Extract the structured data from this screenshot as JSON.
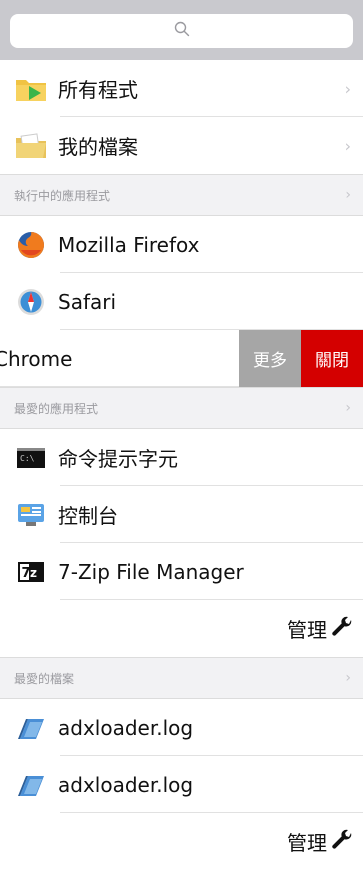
{
  "search": {
    "icon": "search-icon"
  },
  "top_items": [
    {
      "label": "所有程式",
      "icon": "folder-icon"
    },
    {
      "label": "我的檔案",
      "icon": "documents-folder-icon"
    }
  ],
  "running_section": {
    "title": "執行中的應用程式"
  },
  "running_apps": [
    {
      "label": "Mozilla Firefox",
      "icon": "firefox-icon"
    },
    {
      "label": "Safari",
      "icon": "safari-icon"
    }
  ],
  "swiped_row": {
    "label": "Chrome",
    "more_label": "更多",
    "close_label": "關閉"
  },
  "favorite_apps_section": {
    "title": "最愛的應用程式"
  },
  "favorite_apps": [
    {
      "label": "命令提示字元",
      "icon": "terminal-icon"
    },
    {
      "label": "控制台",
      "icon": "control-panel-icon"
    },
    {
      "label": "7-Zip File Manager",
      "icon": "7zip-icon"
    }
  ],
  "manage_label": "管理",
  "favorite_files_section": {
    "title": "最愛的檔案"
  },
  "favorite_files": [
    {
      "label": "adxloader.log",
      "icon": "log-file-icon"
    },
    {
      "label": "adxloader.log",
      "icon": "log-file-icon"
    }
  ],
  "colors": {
    "close": "#d40000",
    "more": "#a6a6a6",
    "section_bg": "#f2f2f4",
    "search_bar": "#c9c9ce"
  }
}
